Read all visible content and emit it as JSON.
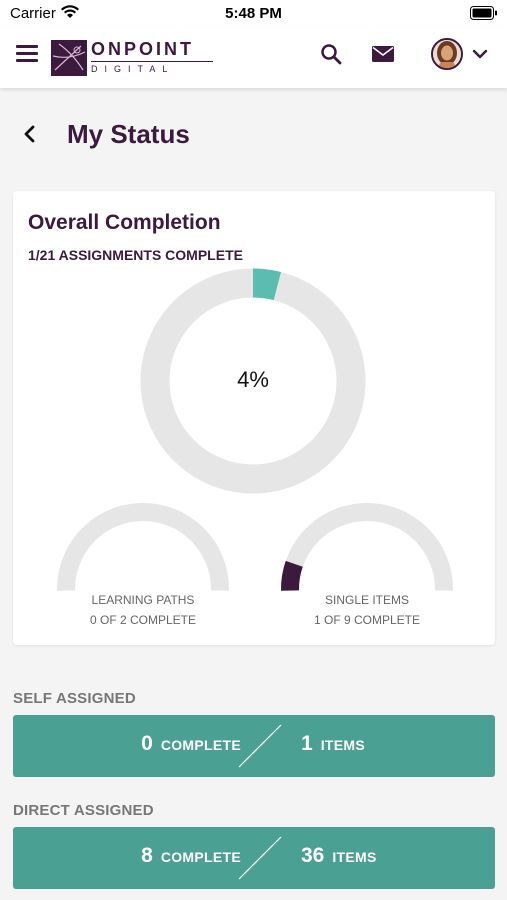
{
  "status_bar": {
    "carrier": "Carrier",
    "time": "5:48 PM"
  },
  "brand": {
    "name_top": "ONPOINT",
    "name_bottom": "DIGITAL",
    "primary_color": "#3b1a3e",
    "accent_color": "#4aa093"
  },
  "nav": {
    "menu_icon": "hamburger-icon",
    "search_icon": "search-icon",
    "mail_icon": "mail-icon",
    "avatar": "user-avatar",
    "dropdown_icon": "chevron-down-icon"
  },
  "page": {
    "title": "My Status",
    "back_icon": "chevron-left-icon"
  },
  "overall": {
    "title": "Overall Completion",
    "subtitle": "1/21 ASSIGNMENTS COMPLETE",
    "percent_label": "4%",
    "percent_value": 0.04,
    "ring_color": "#e6e6e6",
    "fill_color": "#5bbcb0"
  },
  "learning_paths": {
    "label": "LEARNING PATHS",
    "detail": "0 OF 2 COMPLETE",
    "fraction": 0.0
  },
  "single_items": {
    "label": "SINGLE ITEMS",
    "detail": "1 OF 9 COMPLETE",
    "fraction": 0.111,
    "fill_color": "#3b1a3e"
  },
  "self_assigned": {
    "label": "SELF ASSIGNED",
    "complete_count": "0",
    "complete_word": "COMPLETE",
    "items_count": "1",
    "items_word": "ITEMS"
  },
  "direct_assigned": {
    "label": "DIRECT ASSIGNED",
    "complete_count": "8",
    "complete_word": "COMPLETE",
    "items_count": "36",
    "items_word": "ITEMS"
  }
}
